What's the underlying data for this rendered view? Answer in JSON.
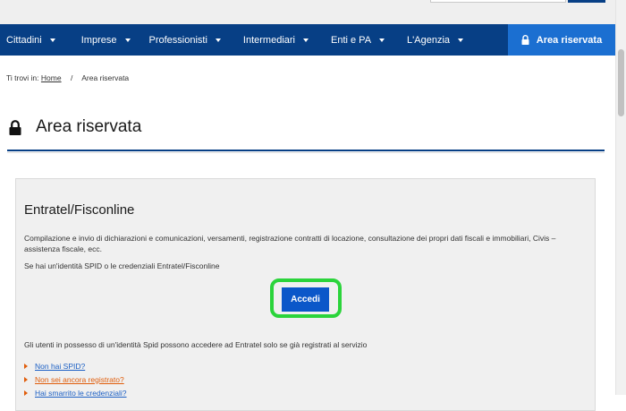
{
  "nav": {
    "items": [
      {
        "label": "Cittadini"
      },
      {
        "label": "Imprese"
      },
      {
        "label": "Professionisti"
      },
      {
        "label": "Intermediari"
      },
      {
        "label": "Enti e PA"
      },
      {
        "label": "L'Agenzia"
      }
    ],
    "reserved_label": "Area riservata"
  },
  "breadcrumb": {
    "prefix": "Ti trovi in:",
    "home": "Home",
    "separator": "/",
    "current": "Area riservata"
  },
  "page": {
    "title": "Area riservata"
  },
  "panel": {
    "heading": "Entratel/Fisconline",
    "description": "Compilazione e invio di dichiarazioni e comunicazioni, versamenti, registrazione contratti di locazione, consultazione dei propri dati fiscali e immobiliari, Civis – assistenza fiscale, ecc.",
    "hint": "Se hai un'identità SPID o le credenziali Entratel/Fisconline",
    "button_label": "Accedi",
    "note": "Gli utenti in possesso di un'identità Spid possono accedere ad Entratel solo se già registrati al servizio",
    "links": [
      {
        "label": "Non hai SPID?",
        "color": "#1b5fc4"
      },
      {
        "label": "Non sei ancora registrato?",
        "color": "#e05d0b"
      },
      {
        "label": "Hai smarrito le credenziali?",
        "color": "#1b5fc4"
      }
    ]
  },
  "colors": {
    "nav_bg": "#073f85",
    "reserved_bg": "#1b6fd1",
    "button_bg": "#0b57c9",
    "highlight_ring": "#2bd43b",
    "bullet": "#e05d0b"
  },
  "icons": {
    "caret": "chevron-down-icon",
    "lock": "lock-icon",
    "bullet": "triangle-right-icon"
  }
}
